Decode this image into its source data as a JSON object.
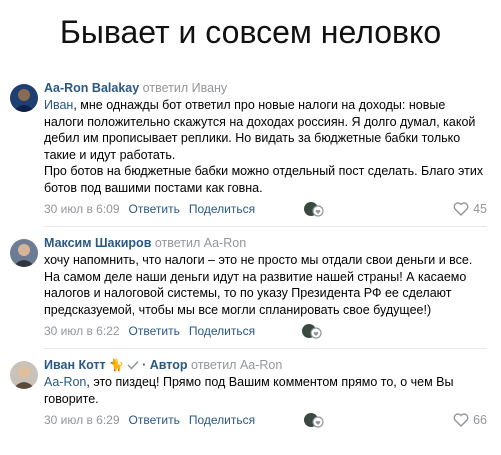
{
  "title": "Бывает и совсем неловко",
  "comments": [
    {
      "author": "Aa-Ron Balakay",
      "replied": "ответил Ивану",
      "mention": "Иван",
      "text": ", мне однажды бот ответил про новые налоги на доходы: новые налоги положительно скажутся на доходах россиян. Я долго думал, какой дебил им прописывает реплики. Но видать за бюджетные бабки только такие и идут работать.\nПро ботов на бюджетные бабки можно отдельный пост сделать. Благо этих ботов под вашими постами как говна.",
      "date": "30 июл в 6:09",
      "reply": "Ответить",
      "share": "Поделиться",
      "likes": "45"
    },
    {
      "author": "Максим Шакиров",
      "replied": "ответил Aa-Ron",
      "mention": "",
      "text": "хочу напомнить, что налоги – это не просто мы отдали свои деньги и все. На самом деле наши деньги идут на развитие нашей страны! А касаемо налогов и налоговой системы, то по указу Президента РФ ее сделают предсказуемой, чтобы мы все могли спланировать свое будущее!)",
      "date": "30 июл в 6:22",
      "reply": "Ответить",
      "share": "Поделиться",
      "likes": ""
    },
    {
      "author": "Иван Котт",
      "badge": "· Автор",
      "replied": "ответил Aa-Ron",
      "mention": "Aa-Ron",
      "text": ", это пиздец! Прямо под Вашим комментом прямо то, о чем Вы говорите.",
      "date": "30 июл в 6:29",
      "reply": "Ответить",
      "share": "Поделиться",
      "likes": "66"
    }
  ],
  "colors": {
    "link": "#2a5885",
    "muted": "#939699",
    "divider": "#e7e8ec"
  }
}
